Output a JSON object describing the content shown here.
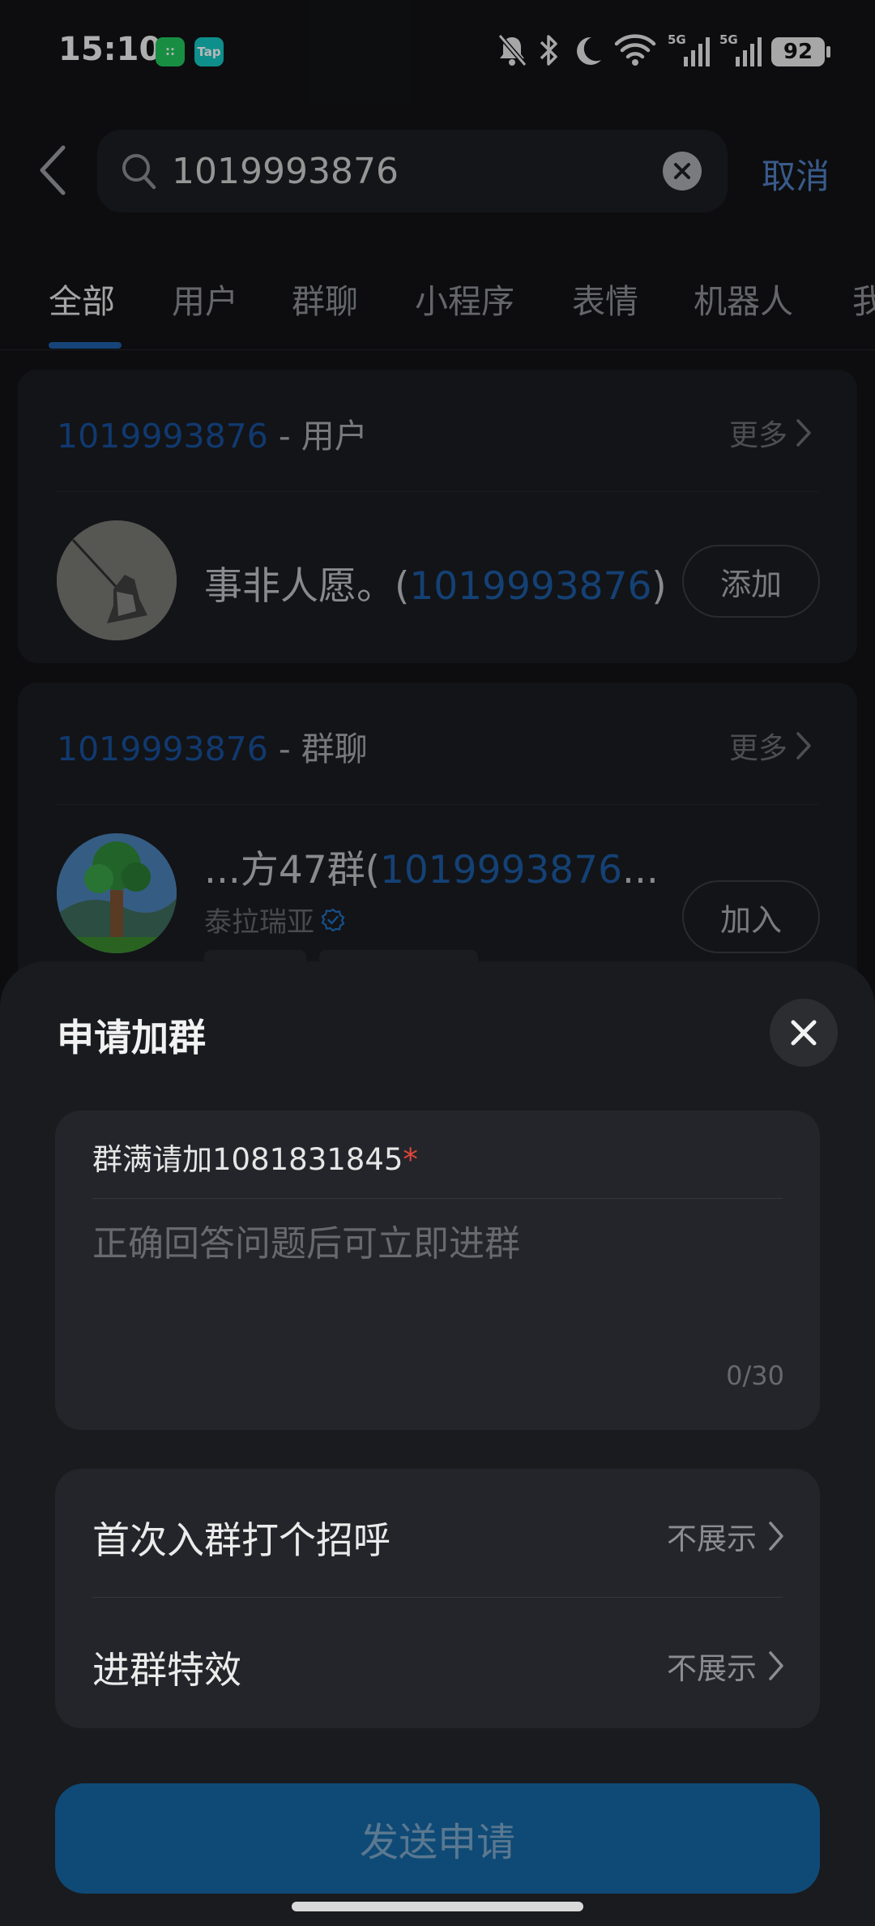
{
  "status_bar": {
    "time": "15:10",
    "app_icons": [
      "∷",
      "Tap"
    ],
    "network_labels": [
      "5G",
      "5G"
    ],
    "battery": "92"
  },
  "search": {
    "query": "1019993876",
    "cancel_label": "取消"
  },
  "tabs": [
    {
      "label": "全部",
      "active": true
    },
    {
      "label": "用户",
      "active": false
    },
    {
      "label": "群聊",
      "active": false
    },
    {
      "label": "小程序",
      "active": false
    },
    {
      "label": "表情",
      "active": false
    },
    {
      "label": "机器人",
      "active": false
    },
    {
      "label": "我",
      "active": false
    }
  ],
  "user_section": {
    "query": "1019993876",
    "suffix": " - 用户",
    "more_label": "更多",
    "result": {
      "name_prefix": "事非人愿。(",
      "name_query": "1019993876",
      "name_suffix": ")",
      "action_label": "添加"
    }
  },
  "group_section": {
    "query": "1019993876",
    "suffix": " - 群聊",
    "more_label": "更多",
    "result": {
      "name_prefix": "...方47群(",
      "name_query": "1019993876",
      "name_suffix": "...",
      "owner": "泰拉瑞亚",
      "action_label": "加入"
    }
  },
  "sheet": {
    "title": "申请加群",
    "question": "群满请加1081831845",
    "required_mark": "*",
    "answer_placeholder": "正确回答问题后可立即进群",
    "char_count": "0/30",
    "options": [
      {
        "label": "首次入群打个招呼",
        "value": "不展示"
      },
      {
        "label": "进群特效",
        "value": "不展示"
      }
    ],
    "submit_label": "发送申请"
  },
  "colors": {
    "accent": "#1f5fa8",
    "submit_bg": "#0f4a76",
    "required": "#e0463a"
  }
}
